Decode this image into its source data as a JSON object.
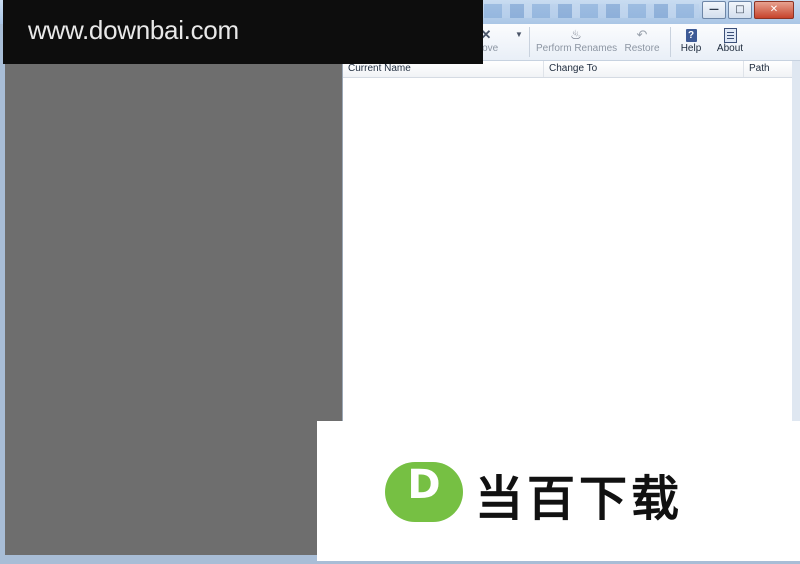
{
  "toolbar": {
    "remove_label": "move",
    "perform_label": "Perform Renames",
    "restore_label": "Restore",
    "help_label": "Help",
    "about_label": "About"
  },
  "window_controls": {
    "minimize": "—",
    "maximize": "□",
    "close": "✕"
  },
  "columns": [
    {
      "label": "Current Name"
    },
    {
      "label": "Change To"
    },
    {
      "label": "Path"
    }
  ],
  "rows": [],
  "watermark": {
    "url": "www.downbai.com",
    "logo_letter": "D",
    "logo_text": "当百下载",
    "logo_color": "#76c043"
  }
}
